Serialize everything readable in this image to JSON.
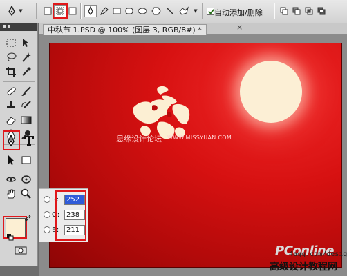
{
  "options_bar": {
    "auto_add_delete_label": "自动添加/删除",
    "auto_add_delete_checked": true
  },
  "document": {
    "tab_title": "中秋节 1.PSD @ 100% (图层 3, RGB/8#) *",
    "close_glyph": "×",
    "foreground_color": "#fcefd3",
    "moon_color": "#fcefd5",
    "canvas_color": "#d71111"
  },
  "toolbox": {
    "header": "▪▪",
    "highlight_color": "#e0181b"
  },
  "color_picker": {
    "r_label": "R:",
    "r_value": "252",
    "g_label": "G:",
    "g_value": "238",
    "b_label": "B:",
    "b_value": "211"
  },
  "watermarks": {
    "forum": "思缘设计论坛",
    "forum_url": "WWW.MISSYUAN.COM",
    "pconline": "PConline",
    "site_url": "4aqq.com/design",
    "site_name": "高级设计教程网"
  }
}
